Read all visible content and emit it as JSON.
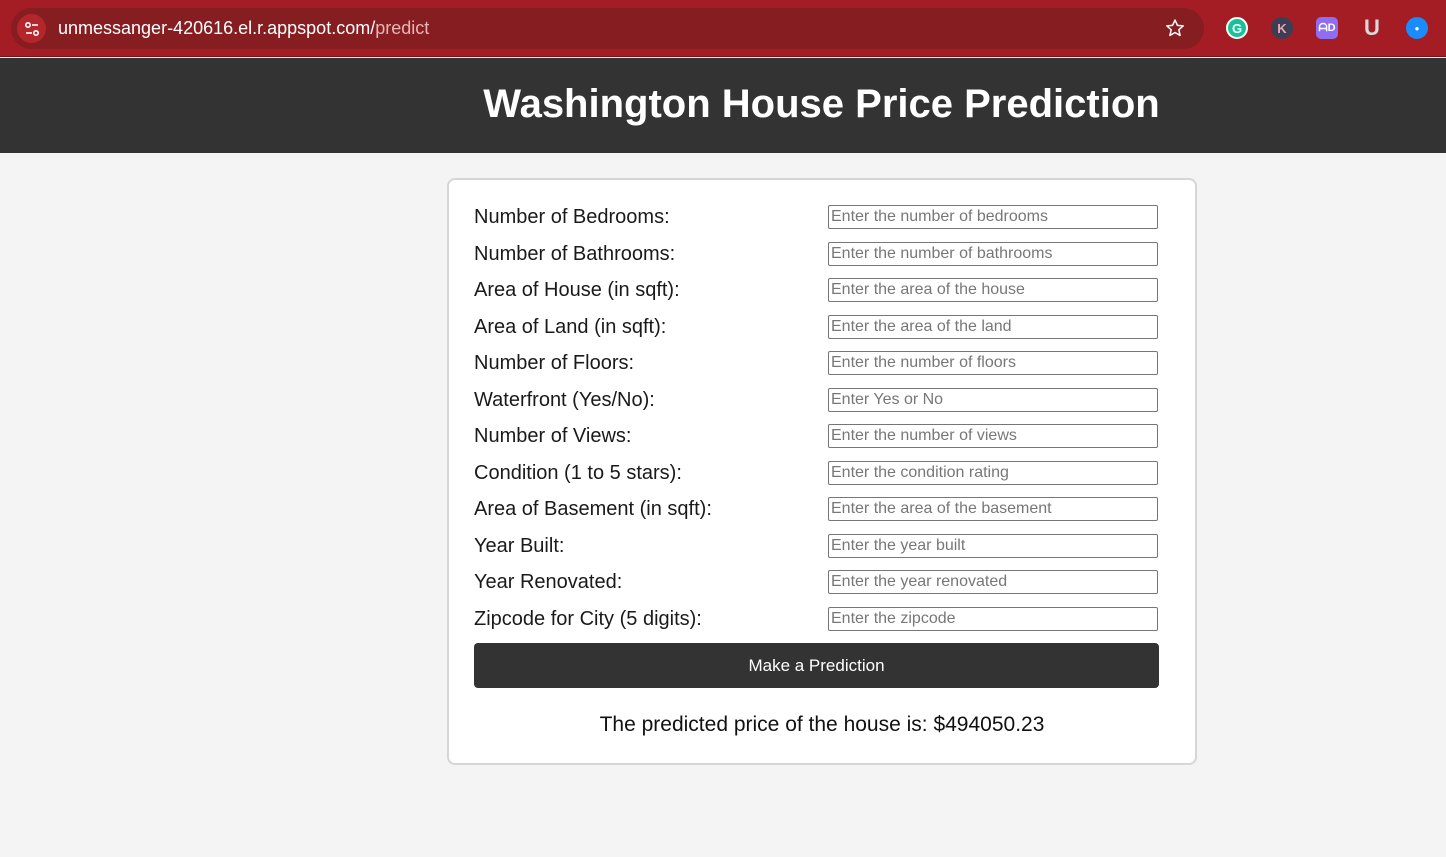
{
  "browser": {
    "url_host": "unmessanger-420616.el.r.appspot.com/",
    "url_path": "predict",
    "extensions": [
      "grammarly-icon",
      "k-extension-icon",
      "ad-extension-icon",
      "u-extension-icon",
      "blue-extension-icon"
    ]
  },
  "header": {
    "title": "Washington House Price Prediction"
  },
  "form": {
    "fields": [
      {
        "label": "Number of Bedrooms:",
        "placeholder": "Enter the number of bedrooms"
      },
      {
        "label": "Number of Bathrooms:",
        "placeholder": "Enter the number of bathrooms"
      },
      {
        "label": "Area of House (in sqft):",
        "placeholder": "Enter the area of the house"
      },
      {
        "label": "Area of Land (in sqft):",
        "placeholder": "Enter the area of the land"
      },
      {
        "label": "Number of Floors:",
        "placeholder": "Enter the number of floors"
      },
      {
        "label": "Waterfront (Yes/No):",
        "placeholder": "Enter Yes or No"
      },
      {
        "label": "Number of Views:",
        "placeholder": "Enter the number of views"
      },
      {
        "label": "Condition (1 to 5 stars):",
        "placeholder": "Enter the condition rating"
      },
      {
        "label": "Area of Basement (in sqft):",
        "placeholder": "Enter the area of the basement"
      },
      {
        "label": "Year Built:",
        "placeholder": "Enter the year built"
      },
      {
        "label": "Year Renovated:",
        "placeholder": "Enter the year renovated"
      },
      {
        "label": "Zipcode for City (5 digits):",
        "placeholder": "Enter the zipcode"
      }
    ],
    "submit_label": "Make a Prediction",
    "result_text": "The predicted price of the house is: $494050.23"
  },
  "colors": {
    "browser_bar": "#a51d24",
    "header_bg": "#333333",
    "button_bg": "#333333"
  }
}
